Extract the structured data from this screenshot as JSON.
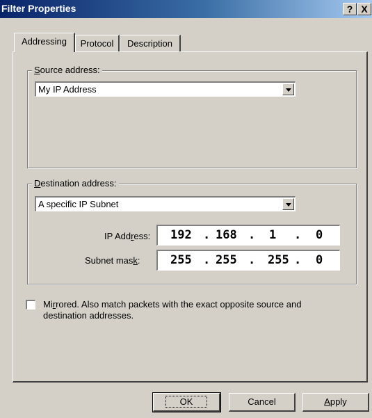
{
  "window": {
    "title": "Filter Properties",
    "help_label": "?",
    "close_label": "X"
  },
  "tabs": [
    {
      "label": "Addressing",
      "active": true
    },
    {
      "label": "Protocol",
      "active": false
    },
    {
      "label": "Description",
      "active": false
    }
  ],
  "source": {
    "group_label_accel": "S",
    "group_label_rest": "ource address:",
    "selected": "My IP Address"
  },
  "destination": {
    "group_label_accel": "D",
    "group_label_rest": "estination address:",
    "selected": "A specific IP Subnet",
    "ip_label_pre": "IP Add",
    "ip_label_accel": "r",
    "ip_label_post": "ess:",
    "ip_octets": [
      "192",
      "168",
      "1",
      "0"
    ],
    "mask_label_pre": "Subnet mas",
    "mask_label_accel": "k",
    "mask_label_post": ":",
    "mask_octets": [
      "255",
      "255",
      "255",
      "0"
    ],
    "separator": "."
  },
  "mirrored": {
    "checked": false,
    "label_pre": "Mi",
    "label_accel": "r",
    "label_post": "rored. Also match packets with the exact opposite source and destination addresses."
  },
  "buttons": {
    "ok": "OK",
    "cancel": "Cancel",
    "apply_accel": "A",
    "apply_rest": "pply"
  }
}
